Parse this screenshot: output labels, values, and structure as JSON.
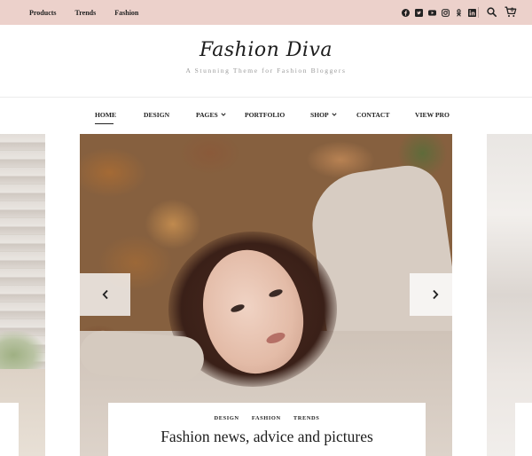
{
  "topbar": {
    "links": [
      "Products",
      "Trends",
      "Fashion"
    ],
    "social_icons": [
      "facebook-icon",
      "twitter-icon",
      "youtube-icon",
      "instagram-icon",
      "odnoklassniki-icon",
      "linkedin-icon"
    ],
    "cart_count": "0",
    "bg_color": "#ecd1cb"
  },
  "brand": {
    "logo": "Fashion Diva",
    "tagline": "A Stunning Theme for Fashion Bloggers"
  },
  "nav": {
    "items": [
      "HOME",
      "DESIGN",
      "PAGES",
      "PORTFOLIO",
      "SHOP",
      "CONTACT",
      "VIEW PRO"
    ],
    "active": "HOME"
  },
  "slider": {
    "categories": [
      "DESIGN",
      "FASHION",
      "TRENDS"
    ],
    "title": "Fashion news, advice and pictures"
  }
}
